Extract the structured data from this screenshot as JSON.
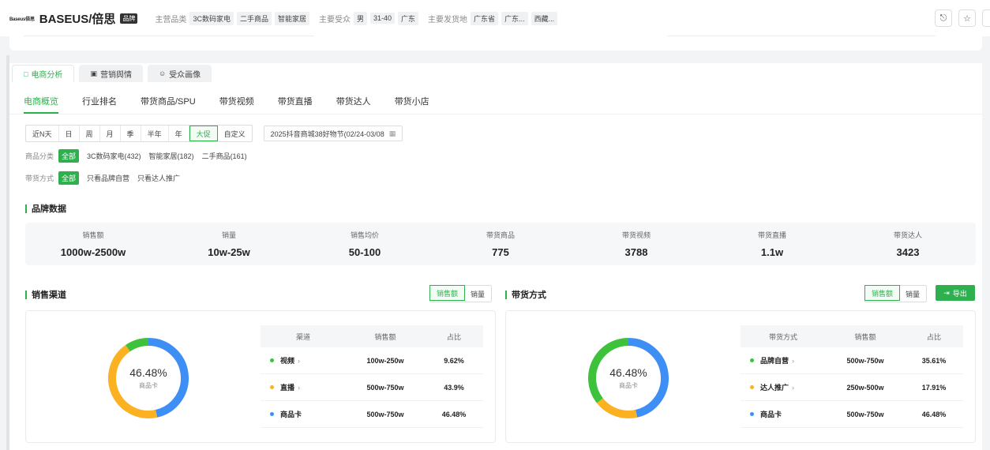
{
  "header": {
    "logo": "Baseus倍思",
    "brand": "BASEUS/倍思",
    "badge": "品牌",
    "category_label": "主营品类",
    "categories": [
      "3C数码家电",
      "二手商品",
      "智能家居"
    ],
    "audience_label": "主要受众",
    "audience": [
      "男",
      "31-40",
      "广东"
    ],
    "ship_label": "主要发货地",
    "ship": [
      "广东省",
      "广东...",
      "西藏..."
    ]
  },
  "top_icons": [
    "refresh-icon",
    "star-icon",
    "doc-icon"
  ],
  "main_tabs": [
    {
      "label": "电商分析",
      "icon": "shop-icon"
    },
    {
      "label": "营销舆情",
      "icon": "chat-icon"
    },
    {
      "label": "受众画像",
      "icon": "user-icon"
    }
  ],
  "sub_tabs": [
    "电商概览",
    "行业排名",
    "带货商品/SPU",
    "带货视频",
    "带货直播",
    "带货达人",
    "带货小店"
  ],
  "time_filter": {
    "options": [
      "近N天",
      "日",
      "周",
      "月",
      "季",
      "半年",
      "年",
      "大促",
      "自定义"
    ],
    "active": "大促",
    "date_value": "2025抖音商城38好物节(02/24-03/08"
  },
  "product_filter": {
    "label": "商品分类",
    "all": "全部",
    "options": [
      "3C数码家电(432)",
      "智能家居(182)",
      "二手商品(161)"
    ]
  },
  "sales_filter": {
    "label": "带货方式",
    "all": "全部",
    "options": [
      "只看品牌自营",
      "只看达人推广"
    ]
  },
  "brand_section": {
    "title": "品牌数据",
    "metrics": [
      {
        "label": "销售额",
        "value": "1000w-2500w"
      },
      {
        "label": "销量",
        "value": "10w-25w"
      },
      {
        "label": "销售均价",
        "value": "50-100"
      },
      {
        "label": "带货商品",
        "value": "775"
      },
      {
        "label": "带货视频",
        "value": "3788"
      },
      {
        "label": "带货直播",
        "value": "1.1w"
      },
      {
        "label": "带货达人",
        "value": "3423"
      }
    ]
  },
  "channel_section": {
    "title": "销售渠道",
    "toggle": [
      "销售额",
      "销量"
    ],
    "center_pct": "46.48%",
    "center_label": "商品卡",
    "headers": [
      "渠道",
      "销售额",
      "占比"
    ],
    "rows": [
      {
        "name": "视频",
        "sales": "100w-250w",
        "pct": "9.62%",
        "color": "#3ec13b",
        "arrow": true,
        "share": 9.62
      },
      {
        "name": "直播",
        "sales": "500w-750w",
        "pct": "43.9%",
        "color": "#fbb122",
        "arrow": true,
        "share": 43.9
      },
      {
        "name": "商品卡",
        "sales": "500w-750w",
        "pct": "46.48%",
        "color": "#3d8ff5",
        "arrow": false,
        "share": 46.48
      }
    ]
  },
  "method_section": {
    "title": "带货方式",
    "toggle": [
      "销售额",
      "销量"
    ],
    "export": "导出",
    "center_pct": "46.48%",
    "center_label": "商品卡",
    "headers": [
      "带货方式",
      "销售额",
      "占比"
    ],
    "rows": [
      {
        "name": "品牌自营",
        "sales": "500w-750w",
        "pct": "35.61%",
        "color": "#3ec13b",
        "arrow": true,
        "share": 35.61
      },
      {
        "name": "达人推广",
        "sales": "250w-500w",
        "pct": "17.91%",
        "color": "#fbb122",
        "arrow": true,
        "share": 17.91
      },
      {
        "name": "商品卡",
        "sales": "500w-750w",
        "pct": "46.48%",
        "color": "#3d8ff5",
        "arrow": false,
        "share": 46.48
      }
    ]
  },
  "accent_color": "#2fb04f"
}
